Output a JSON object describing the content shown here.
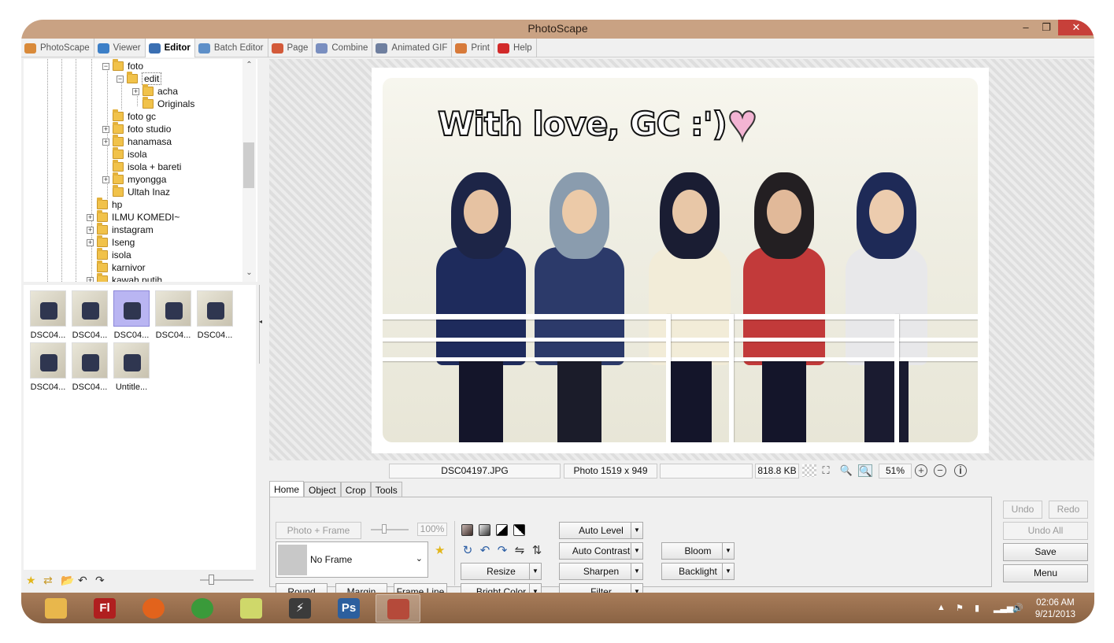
{
  "window": {
    "title": "PhotoScape",
    "minimize": "–",
    "restore": "❐",
    "close": "✕"
  },
  "tabs": [
    {
      "label": "PhotoScape",
      "icon": "photoscape-icon",
      "color": "#d98a3a"
    },
    {
      "label": "Viewer",
      "icon": "viewer-icon",
      "color": "#3c7fc7"
    },
    {
      "label": "Editor",
      "icon": "editor-icon",
      "color": "#3a6fb2",
      "active": true
    },
    {
      "label": "Batch Editor",
      "icon": "batch-editor-icon",
      "color": "#5e8fc8"
    },
    {
      "label": "Page",
      "icon": "page-icon",
      "color": "#d35a3a"
    },
    {
      "label": "Combine",
      "icon": "combine-icon",
      "color": "#7a8fc0"
    },
    {
      "label": "Animated GIF",
      "icon": "animated-gif-icon",
      "color": "#6f7f9f"
    },
    {
      "label": "Print",
      "icon": "print-icon",
      "color": "#d77a3a"
    },
    {
      "label": "Help",
      "icon": "help-icon",
      "color": "#d22a2a"
    }
  ],
  "tree": {
    "nodes": [
      {
        "label": "foto",
        "expander": "⊟"
      },
      {
        "label": "edit",
        "expander": "⊟",
        "selected": true
      },
      {
        "label": "acha",
        "expander": "⊞"
      },
      {
        "label": "Originals",
        "expander": ""
      },
      {
        "label": "foto gc",
        "expander": ""
      },
      {
        "label": "foto studio",
        "expander": "⊞"
      },
      {
        "label": "hanamasa",
        "expander": "⊞"
      },
      {
        "label": "isola",
        "expander": ""
      },
      {
        "label": "isola + bareti",
        "expander": ""
      },
      {
        "label": "myongga",
        "expander": "⊞"
      },
      {
        "label": "Ultah Inaz",
        "expander": ""
      },
      {
        "label": "hp",
        "expander": ""
      },
      {
        "label": "ILMU KOMEDI~",
        "expander": "⊞"
      },
      {
        "label": "instagram",
        "expander": "⊞"
      },
      {
        "label": "Iseng",
        "expander": "⊞"
      },
      {
        "label": "isola",
        "expander": ""
      },
      {
        "label": "karnivor",
        "expander": ""
      },
      {
        "label": "kawah putih",
        "expander": "⊞"
      }
    ]
  },
  "thumbnails": [
    {
      "caption": "DSC04..."
    },
    {
      "caption": "DSC04..."
    },
    {
      "caption": "DSC04...",
      "selected": true
    },
    {
      "caption": "DSC04..."
    },
    {
      "caption": "DSC04..."
    },
    {
      "caption": "DSC04..."
    },
    {
      "caption": "DSC04..."
    },
    {
      "caption": "Untitle..."
    }
  ],
  "left_toolbar": {
    "icons": [
      "star-icon",
      "swap-icon",
      "folder-open-icon",
      "back-icon",
      "forward-icon"
    ],
    "glyphs": [
      "★",
      "⇄",
      "📂",
      "↶",
      "↷"
    ]
  },
  "photo": {
    "caption_text": "With love, GC :')",
    "heart": "♥"
  },
  "status": {
    "filename": "DSC04197.JPG",
    "dimensions": "Photo 1519 x 949",
    "empty": "",
    "size": "818.8 KB",
    "zoom": "51%",
    "zoom_in": "+",
    "zoom_out": "−",
    "info": "i"
  },
  "edit_tabs": [
    {
      "label": "Home",
      "active": true
    },
    {
      "label": "Object"
    },
    {
      "label": "Crop"
    },
    {
      "label": "Tools"
    }
  ],
  "edit": {
    "photo_frame": "Photo + Frame",
    "percent": "100%",
    "frame_value": "No Frame",
    "round": "Round",
    "margin": "Margin",
    "frame_line": "Frame Line",
    "auto_level": "Auto Level",
    "auto_contrast": "Auto Contrast",
    "sharpen": "Sharpen",
    "filter": "Filter",
    "resize": "Resize",
    "bright_color": "Bright,Color",
    "bloom": "Bloom",
    "backlight": "Backlight",
    "dropdown_arrow": "▼",
    "rotate_glyphs": [
      "↻",
      "↶",
      "↷",
      "⇋",
      "⇅"
    ]
  },
  "right_panel": {
    "undo": "Undo",
    "redo": "Redo",
    "undo_all": "Undo All",
    "save": "Save",
    "menu": "Menu"
  },
  "taskbar": {
    "apps": [
      {
        "name": "file-explorer",
        "label": "",
        "color": "#e8b74c"
      },
      {
        "name": "flash",
        "label": "Fl",
        "color": "#b01f1f"
      },
      {
        "name": "firefox",
        "label": "",
        "color": "#e2631c"
      },
      {
        "name": "chrome",
        "label": "",
        "color": "#3a9a3a"
      },
      {
        "name": "sticky-notes",
        "label": "",
        "color": "#cfd86a"
      },
      {
        "name": "winamp",
        "label": "⚡",
        "color": "#3b3b3b"
      },
      {
        "name": "photoshop",
        "label": "Ps",
        "color": "#2c5f9e"
      },
      {
        "name": "photoscape",
        "label": "",
        "color": "#b54a3a",
        "active": true
      }
    ],
    "tray_glyphs": [
      "▲",
      "⚑",
      "▮",
      "▂▃▅",
      "🔊"
    ],
    "time": "02:06 AM",
    "date": "9/21/2013"
  },
  "colors": {
    "titlebar": "#c9a283",
    "taskbar": "#9a7050",
    "close": "#c7403a",
    "selection": "#b9b5f2"
  }
}
